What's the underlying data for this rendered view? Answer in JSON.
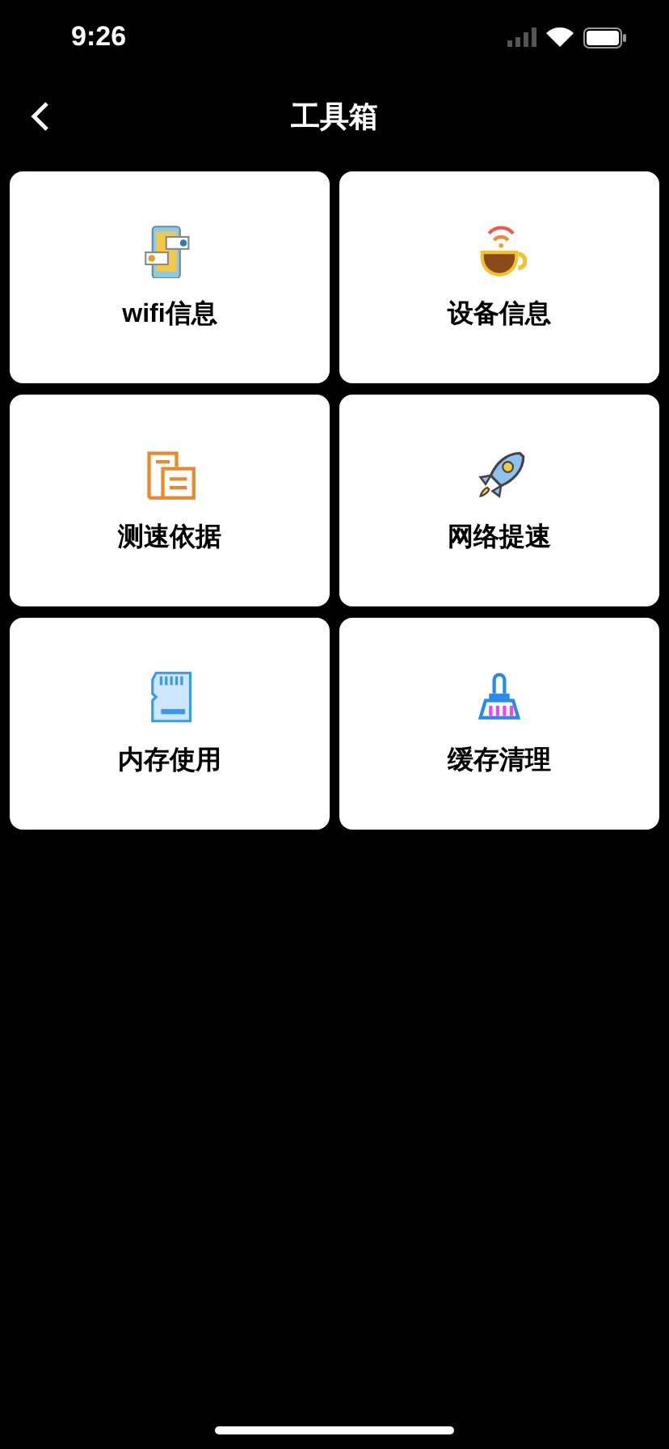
{
  "status_bar": {
    "time": "9:26"
  },
  "nav": {
    "title": "工具箱"
  },
  "tools": [
    {
      "label": "wifi信息"
    },
    {
      "label": "设备信息"
    },
    {
      "label": "测速依据"
    },
    {
      "label": "网络提速"
    },
    {
      "label": "内存使用"
    },
    {
      "label": "缓存清理"
    }
  ]
}
